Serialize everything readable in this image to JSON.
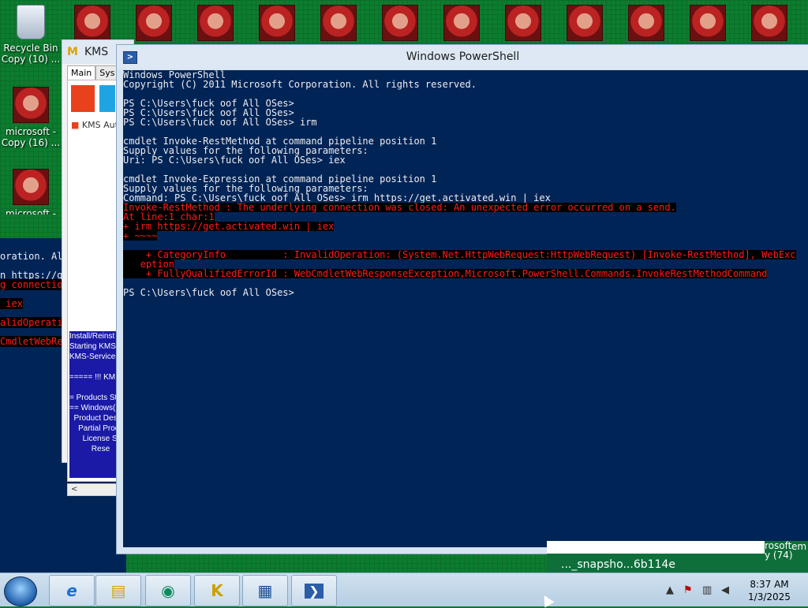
{
  "desktop": {
    "icons": [
      {
        "label": "Recycle Bin\nCopy (10) ...",
        "icon": "recycle-bin-icon"
      },
      {
        "label": "microsoft -\nCopy (16) ...",
        "icon": "photo-icon"
      },
      {
        "label": "microsoft -",
        "icon": "photo-icon"
      }
    ]
  },
  "background_console": {
    "lines": [
      {
        "text": "oration. Al",
        "type": "normal"
      },
      {
        "text": "n https://g",
        "type": "normal"
      },
      {
        "text": "g connectio",
        "type": "error"
      },
      {
        "text": " iex",
        "type": "error"
      },
      {
        "text": "alidOperati",
        "type": "error"
      },
      {
        "text": "CmdletWebRe",
        "type": "error"
      }
    ]
  },
  "kms_window": {
    "title": "KMS",
    "tabs": [
      "Main",
      "Sys"
    ],
    "brand": "KMS Aut",
    "log_lines": [
      "Install/Reinst",
      "Starting KMS-",
      "KMS-Services",
      "",
      "===== !!! KM",
      "",
      "= Products Sta",
      "== Windows(R",
      "  Product Desc",
      "    Partial Proc",
      "      License St",
      "          Rese"
    ],
    "scroll_arrow": "<"
  },
  "powershell": {
    "title": "Windows PowerShell",
    "lines": [
      {
        "text": "Windows PowerShell",
        "type": "normal"
      },
      {
        "text": "Copyright (C) 2011 Microsoft Corporation. All rights reserved.",
        "type": "normal"
      },
      {
        "text": "",
        "type": "normal"
      },
      {
        "text": "PS C:\\Users\\fuck oof All OSes>",
        "type": "normal"
      },
      {
        "text": "PS C:\\Users\\fuck oof All OSes>",
        "type": "normal"
      },
      {
        "text": "PS C:\\Users\\fuck oof All OSes> irm",
        "type": "normal"
      },
      {
        "text": "",
        "type": "normal"
      },
      {
        "text": "cmdlet Invoke-RestMethod at command pipeline position 1",
        "type": "normal"
      },
      {
        "text": "Supply values for the following parameters:",
        "type": "normal"
      },
      {
        "text": "Uri: PS C:\\Users\\fuck oof All OSes> iex",
        "type": "normal"
      },
      {
        "text": "",
        "type": "normal"
      },
      {
        "text": "cmdlet Invoke-Expression at command pipeline position 1",
        "type": "normal"
      },
      {
        "text": "Supply values for the following parameters:",
        "type": "normal"
      },
      {
        "text": "Command: PS C:\\Users\\fuck oof All OSes> irm https://get.activated.win | iex",
        "type": "normal"
      },
      {
        "text": "Invoke-RestMethod : The underlying connection was closed: An unexpected error occurred on a send.",
        "type": "error"
      },
      {
        "text": "At line:1 char:1",
        "type": "error"
      },
      {
        "text": "+ irm https://get.activated.win | iex",
        "type": "error"
      },
      {
        "text": "+ ~~~~",
        "type": "error"
      },
      {
        "text": "",
        "type": "normal"
      },
      {
        "text": "    + CategoryInfo          : InvalidOperation: (System.Net.HttpWebRequest:HttpWebRequest) [Invoke-RestMethod], WebExc",
        "type": "error"
      },
      {
        "text": "   eption",
        "type": "error"
      },
      {
        "text": "    + FullyQualifiedErrorId : WebCmdletWebResponseException,Microsoft.PowerShell.Commands.InvokeRestMethodCommand",
        "type": "error"
      },
      {
        "text": "",
        "type": "normal"
      },
      {
        "text": "PS C:\\Users\\fuck oof All OSes>",
        "type": "normal"
      }
    ]
  },
  "notification": {
    "text": "..._snapsho...6b114e",
    "side_lines": [
      "rosoft",
      "y (74)"
    ],
    "side_right": "em"
  },
  "taskbar": {
    "items": [
      {
        "name": "internet-explorer",
        "icon": "ie-icon",
        "glyph": "e"
      },
      {
        "name": "file-explorer",
        "icon": "folder-icon",
        "glyph": "▤"
      },
      {
        "name": "app-green",
        "icon": "refresh-icon",
        "glyph": "◉"
      },
      {
        "name": "kms-app",
        "icon": "kms-icon",
        "glyph": "K"
      },
      {
        "name": "control-panel",
        "icon": "control-panel-icon",
        "glyph": "▦"
      },
      {
        "name": "powershell",
        "icon": "powershell-icon",
        "glyph": "❯"
      }
    ],
    "time": "8:37 AM",
    "date": "1/3/2025",
    "tray_icons": [
      "up-arrow-icon",
      "flag-icon",
      "network-icon",
      "volume-icon"
    ]
  }
}
